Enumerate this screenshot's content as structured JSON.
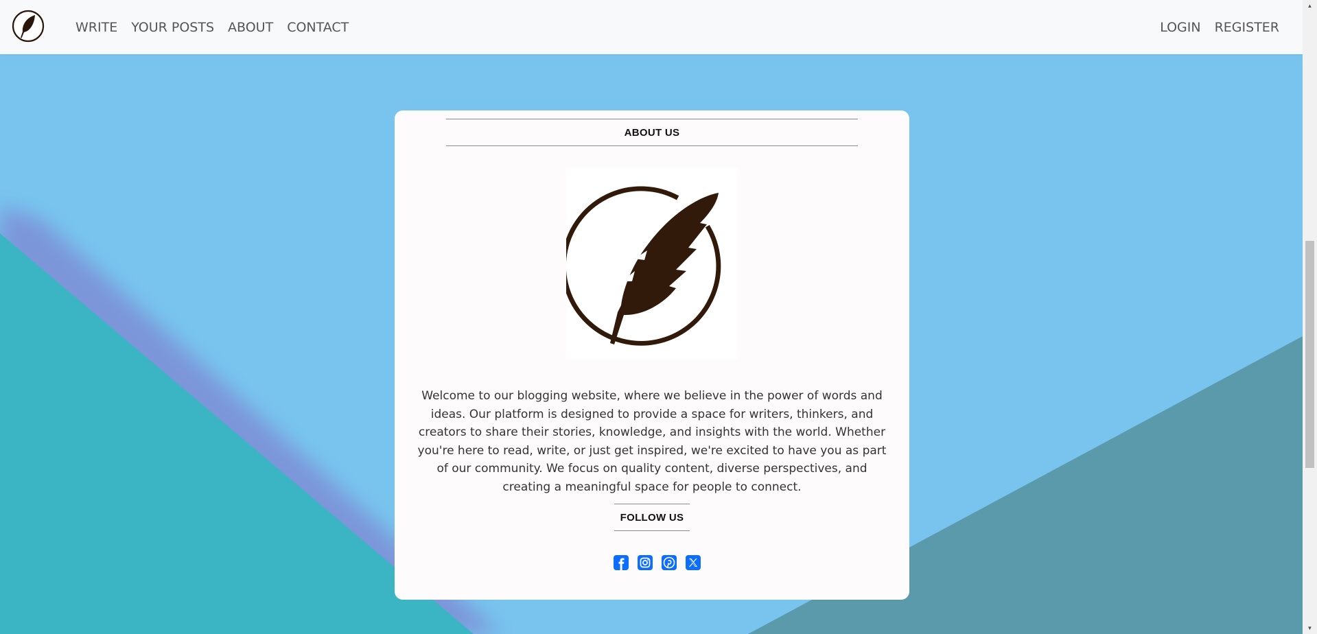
{
  "navbar": {
    "brand_icon": "feather-logo-icon",
    "left_links": [
      "WRITE",
      "YOUR POSTS",
      "ABOUT",
      "CONTACT"
    ],
    "right_links": [
      "LOGIN",
      "REGISTER"
    ]
  },
  "about": {
    "title": "ABOUT US",
    "logo_icon": "feather-circle-logo-icon",
    "text": "Welcome to our blogging website, where we believe in the power of words and ideas. Our platform is designed to provide a space for writers, thinkers, and creators to share their stories, knowledge, and insights with the world. Whether you're here to read, write, or just get inspired, we're excited to have you as part of our community. We focus on quality content, diverse perspectives, and creating a meaningful space for people to connect."
  },
  "follow": {
    "title": "FOLLOW US",
    "icons": [
      "facebook-icon",
      "instagram-icon",
      "pinterest-icon",
      "x-twitter-icon"
    ]
  },
  "colors": {
    "background": "#78c4ee",
    "teal_shape": "#3bb5c4",
    "gray_shape": "#5b9aab",
    "navbar": "#f8f9fa",
    "card": "#fdfbfb",
    "logo_brown": "#321a0b",
    "social_blue": "#0d6efd"
  }
}
